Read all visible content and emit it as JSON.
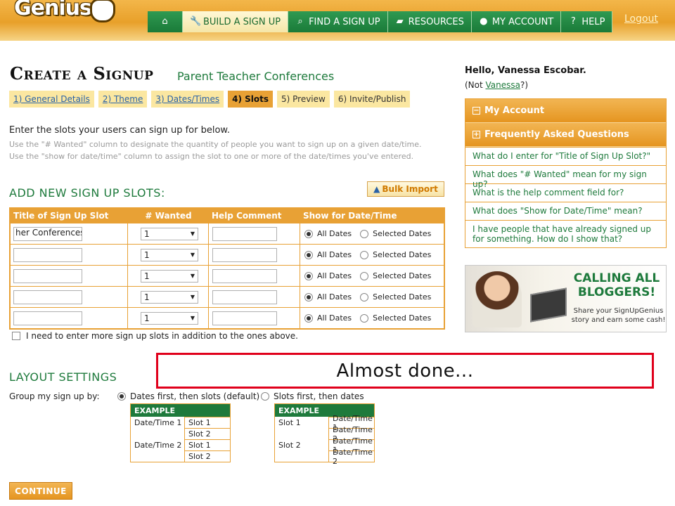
{
  "header": {
    "logo_text": "Genius",
    "nav": [
      {
        "label": "",
        "icon": "home-icon"
      },
      {
        "label": "BUILD A SIGN UP",
        "icon": "wrench-icon"
      },
      {
        "label": "FIND A SIGN UP",
        "icon": "search-icon"
      },
      {
        "label": "RESOURCES",
        "icon": "folder-icon"
      },
      {
        "label": "MY ACCOUNT",
        "icon": "user-icon"
      },
      {
        "label": "HELP",
        "icon": "question-icon"
      }
    ],
    "active_nav": "BUILD A SIGN UP",
    "logout": "Logout"
  },
  "page": {
    "title": "Create a Signup",
    "subtitle": "Parent Teacher Conferences"
  },
  "steps": [
    "1) General Details",
    "2) Theme",
    "3) Dates/Times",
    "4) Slots",
    "5) Preview",
    "6) Invite/Publish"
  ],
  "active_step": "4) Slots",
  "intro": {
    "main": "Enter the slots your users can sign up for below.",
    "hint": "Use the \"# Wanted\" column to designate the quantity of people you want to sign up on a given date/time. Use the \"show for date/time\" column to assign the slot to one or more of the date/times you've entered."
  },
  "slots_section": {
    "heading": "ADD NEW SIGN UP SLOTS:",
    "bulk_import": "Bulk Import",
    "columns": [
      "Title of Sign Up Slot",
      "# Wanted",
      "Help Comment",
      "Show for Date/Time"
    ],
    "rows": [
      {
        "title": "her Conferences",
        "wanted": "1",
        "help": "",
        "show": "All Dates"
      },
      {
        "title": "",
        "wanted": "1",
        "help": "",
        "show": "All Dates"
      },
      {
        "title": "",
        "wanted": "1",
        "help": "",
        "show": "All Dates"
      },
      {
        "title": "",
        "wanted": "1",
        "help": "",
        "show": "All Dates"
      },
      {
        "title": "",
        "wanted": "1",
        "help": "",
        "show": "All Dates"
      }
    ],
    "option_all": "All Dates",
    "option_selected": "Selected Dates",
    "more_slots": "I need to enter more sign up slots in addition to the ones above."
  },
  "layout_settings": {
    "heading": "LAYOUT SETTINGS",
    "group_label": "Group my sign up by:",
    "option_dates_first": "Dates first, then slots (default)",
    "option_slots_first": "Slots first, then dates",
    "selected": "Dates first, then slots (default)",
    "example_label": "EXAMPLE",
    "example_dates_first": [
      {
        "left": "Date/Time 1",
        "right": "Slot 1"
      },
      {
        "left": "",
        "right": "Slot 2"
      },
      {
        "left": "Date/Time 2",
        "right": "Slot 1"
      },
      {
        "left": "",
        "right": "Slot 2"
      }
    ],
    "example_slots_first": [
      {
        "left": "Slot 1",
        "right": "Date/Time 1"
      },
      {
        "left": "",
        "right": "Date/Time 2"
      },
      {
        "left": "Slot 2",
        "right": "Date/Time 1"
      },
      {
        "left": "",
        "right": "Date/Time 2"
      }
    ]
  },
  "continue_button": "CONTINUE",
  "sidebar": {
    "greeting": "Hello, Vanessa Escobar.",
    "not_prefix": "(Not ",
    "not_link": "Vanessa",
    "not_suffix": "?)",
    "my_account": "My Account",
    "faq_heading": "Frequently Asked Questions",
    "faqs": [
      "What do I enter for \"Title of Sign Up Slot?\"",
      "What does \"# Wanted\" mean for my sign up?",
      "What is the help comment field for?",
      "What does \"Show for Date/Time\" mean?",
      "I have people that have already signed up for something. How do I show that?"
    ],
    "ad_title": "CALLING ALL BLOGGERS!",
    "ad_sub": "Share your SignUpGenius story and earn some cash!"
  },
  "overlay_caption": "Almost done..."
}
